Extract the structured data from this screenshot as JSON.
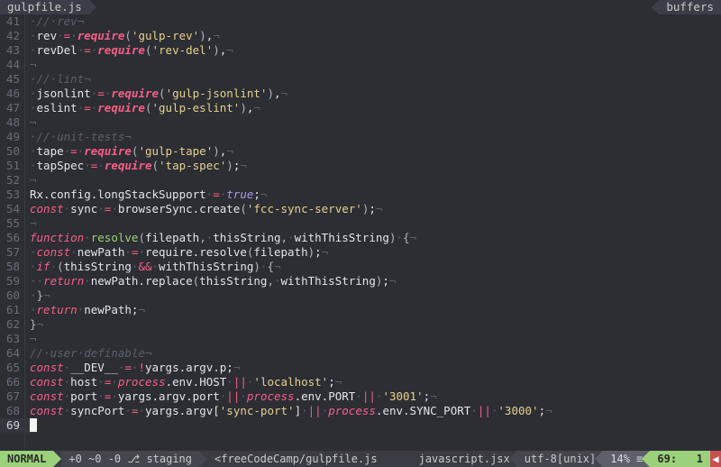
{
  "tabline": {
    "left_tab": "gulpfile.js",
    "right_tab": "buffers"
  },
  "lines": [
    {
      "n": 41,
      "kind": "comment",
      "dots": 1,
      "text": "// rev"
    },
    {
      "n": 42,
      "kind": "assign",
      "dots": 1,
      "name": "rev",
      "req": "gulp-rev",
      "tail": ","
    },
    {
      "n": 43,
      "kind": "assign",
      "dots": 1,
      "name": "revDel",
      "req": "rev-del",
      "tail": ","
    },
    {
      "n": 44,
      "kind": "blank"
    },
    {
      "n": 45,
      "kind": "comment",
      "dots": 1,
      "text": "// lint"
    },
    {
      "n": 46,
      "kind": "assign",
      "dots": 1,
      "name": "jsonlint",
      "req": "gulp-jsonlint",
      "tail": ","
    },
    {
      "n": 47,
      "kind": "assign",
      "dots": 1,
      "name": "eslint",
      "req": "gulp-eslint",
      "tail": ","
    },
    {
      "n": 48,
      "kind": "blank"
    },
    {
      "n": 49,
      "kind": "comment",
      "dots": 1,
      "text": "// unit-tests"
    },
    {
      "n": 50,
      "kind": "assign",
      "dots": 1,
      "name": "tape",
      "req": "gulp-tape",
      "tail": ","
    },
    {
      "n": 51,
      "kind": "assign",
      "dots": 1,
      "name": "tapSpec",
      "req": "tap-spec",
      "tail": ";"
    },
    {
      "n": 52,
      "kind": "blank"
    },
    {
      "n": 53,
      "kind": "raw53"
    },
    {
      "n": 54,
      "kind": "raw54"
    },
    {
      "n": 55,
      "kind": "blank"
    },
    {
      "n": 56,
      "kind": "raw56"
    },
    {
      "n": 57,
      "kind": "raw57"
    },
    {
      "n": 58,
      "kind": "raw58"
    },
    {
      "n": 59,
      "kind": "raw59"
    },
    {
      "n": 60,
      "kind": "brace",
      "dots": 1,
      "ch": "}"
    },
    {
      "n": 61,
      "kind": "raw61"
    },
    {
      "n": 62,
      "kind": "brace",
      "dots": 0,
      "ch": "}"
    },
    {
      "n": 63,
      "kind": "blank"
    },
    {
      "n": 64,
      "kind": "comment",
      "dots": 0,
      "text": "// user definable"
    },
    {
      "n": 65,
      "kind": "raw65"
    },
    {
      "n": 66,
      "kind": "raw66"
    },
    {
      "n": 67,
      "kind": "raw67"
    },
    {
      "n": 68,
      "kind": "raw68"
    },
    {
      "n": 69,
      "kind": "cursor"
    }
  ],
  "strings": {
    "require": "require",
    "const": "const",
    "function": "function",
    "return": "return",
    "if": "if",
    "true": "true",
    "process": "process",
    "l53_a": "Rx.config.longStackSupport",
    "l54_sync": "sync",
    "l54_call": "browserSync.create",
    "l54_arg": "fcc-sync-server",
    "l56_name": "resolve",
    "l56_args": "filepath, thisString, withThisString",
    "l57_name": "newPath",
    "l57_rhs": "require.resolve(filepath)",
    "l58_cond_a": "thisString",
    "l58_cond_b": "withThisString",
    "l59_rhs": "newPath.replace(thisString, withThisString)",
    "l61_rhs": "newPath",
    "l65_name": "__DEV__",
    "l65_rhs": "yargs.argv.p",
    "l66_name": "host",
    "l66_env": "env.HOST",
    "l66_def": "localhost",
    "l67_name": "port",
    "l67_pre": "yargs.argv.port",
    "l67_env": "env.PORT",
    "l67_def": "3001",
    "l68_name": "syncPort",
    "l68_pre1": "yargs.argv[",
    "l68_key": "sync-port",
    "l68_pre2": "]",
    "l68_env": "env.SYNC_PORT",
    "l68_def": "3000"
  },
  "status": {
    "mode": "NORMAL",
    "gitstats": "+0 ~0 -0",
    "branch": "staging",
    "path": "<freeCodeCamp/gulpfile.js",
    "filetype": "javascript.jsx",
    "encoding": "utf-8[unix]",
    "percent": "14%",
    "line": "69:",
    "col": "1"
  }
}
